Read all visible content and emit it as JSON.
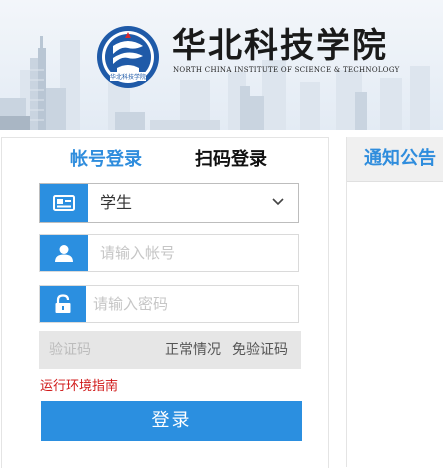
{
  "header": {
    "school_name": "华北科技学院",
    "school_name_en": "NORTH CHINA INSTITUTE OF SCIENCE & TECHNOLOGY",
    "logo_text": "华北科技学院"
  },
  "login": {
    "tabs": [
      {
        "label": "帐号登录",
        "active": true
      },
      {
        "label": "扫码登录",
        "active": false
      }
    ],
    "role_select": {
      "value": "学生"
    },
    "username": {
      "placeholder": "请输入帐号"
    },
    "password": {
      "placeholder": "请输入密码"
    },
    "captcha": {
      "placeholder": "验证码",
      "status": "正常情况",
      "free_label": "免验证码"
    },
    "guide_link": "运行环境指南",
    "submit_label": "登录"
  },
  "notice": {
    "title": "通知公告"
  },
  "colors": {
    "accent": "#2b8fe0",
    "tab_active": "#2f8ddd",
    "link_red": "#d01818"
  }
}
